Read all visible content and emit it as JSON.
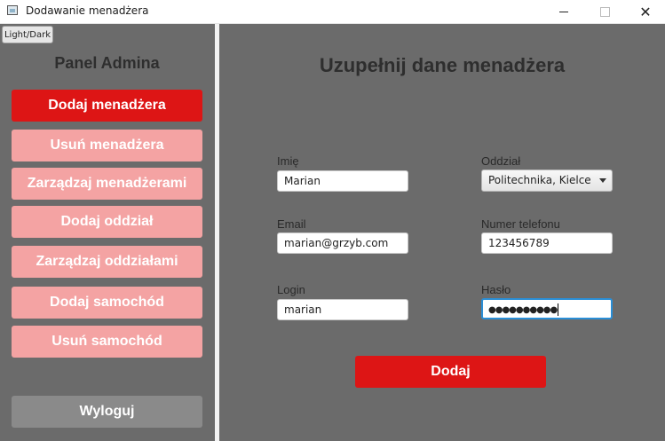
{
  "window": {
    "title": "Dodawanie menadżera"
  },
  "toolbar": {
    "theme_toggle": "Light/Dark"
  },
  "sidebar": {
    "title": "Panel Admina",
    "items": [
      {
        "label": "Dodaj menadżera",
        "active": true
      },
      {
        "label": "Usuń menadżera",
        "active": false
      },
      {
        "label": "Zarządzaj menadżerami",
        "active": false
      },
      {
        "label": "Dodaj oddział",
        "active": false
      },
      {
        "label": "Zarządzaj oddziałami",
        "active": false
      },
      {
        "label": "Dodaj samochód",
        "active": false
      },
      {
        "label": "Usuń samochód",
        "active": false
      }
    ],
    "logout": "Wyloguj"
  },
  "form": {
    "title": "Uzupełnij dane menadżera",
    "first_name": {
      "label": "Imię",
      "value": "Marian"
    },
    "branch": {
      "label": "Oddział",
      "value": "Politechnika, Kielce"
    },
    "email": {
      "label": "Email",
      "value": "marian@grzyb.com"
    },
    "phone": {
      "label": "Numer telefonu",
      "value": "123456789"
    },
    "login": {
      "label": "Login",
      "value": "marian"
    },
    "password": {
      "label": "Hasło",
      "value": "●●●●●●●●●●"
    },
    "submit": "Dodaj"
  },
  "colors": {
    "accent": "#dd1515",
    "inactive_button": "#f4a3a3",
    "background": "#6b6b6b",
    "logout_button": "#8a8a8a",
    "focus_border": "#2a8ed6"
  },
  "icons": {
    "app": "window-app-icon",
    "minimize": "minimize-icon",
    "maximize": "maximize-icon",
    "close": "close-icon",
    "dropdown": "chevron-down-icon"
  }
}
